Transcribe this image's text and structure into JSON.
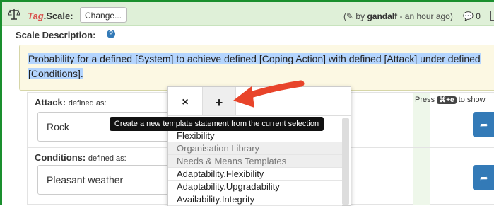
{
  "header": {
    "tag_prefix": "Tag",
    "tag_suffix": ".Scale:",
    "change_label": "Change...",
    "byline_prefix": "by",
    "author": "gandalf",
    "time": "- an hour ago)",
    "byline_open": "(",
    "comment_count": "0"
  },
  "scale_description": {
    "label": "Scale Description:",
    "help": "?",
    "text": "Probability for a defined [System] to achieve defined [Coping Action] with defined [Attack] under defined [Conditions]."
  },
  "fields": [
    {
      "label": "Attack:",
      "sublabel": "defined as:",
      "value": "Rock"
    },
    {
      "label": "Conditions:",
      "sublabel": "defined as:",
      "value": "Pleasant weather"
    }
  ],
  "press_hint": {
    "prefix": "Press",
    "key": "⌘+e",
    "suffix": "to show"
  },
  "popup": {
    "close": "×",
    "add": "+",
    "tooltip": "Create a new template statement from the current selection",
    "items": [
      {
        "label": "Flexibility",
        "header": false
      },
      {
        "label": "Organisation Library",
        "header": true
      },
      {
        "label": "Needs & Means Templates",
        "header": true
      },
      {
        "label": "Adaptability.Flexibility",
        "header": false
      },
      {
        "label": "Adaptability.Upgradability",
        "header": false
      },
      {
        "label": "Availability.Integrity",
        "header": false
      }
    ]
  }
}
